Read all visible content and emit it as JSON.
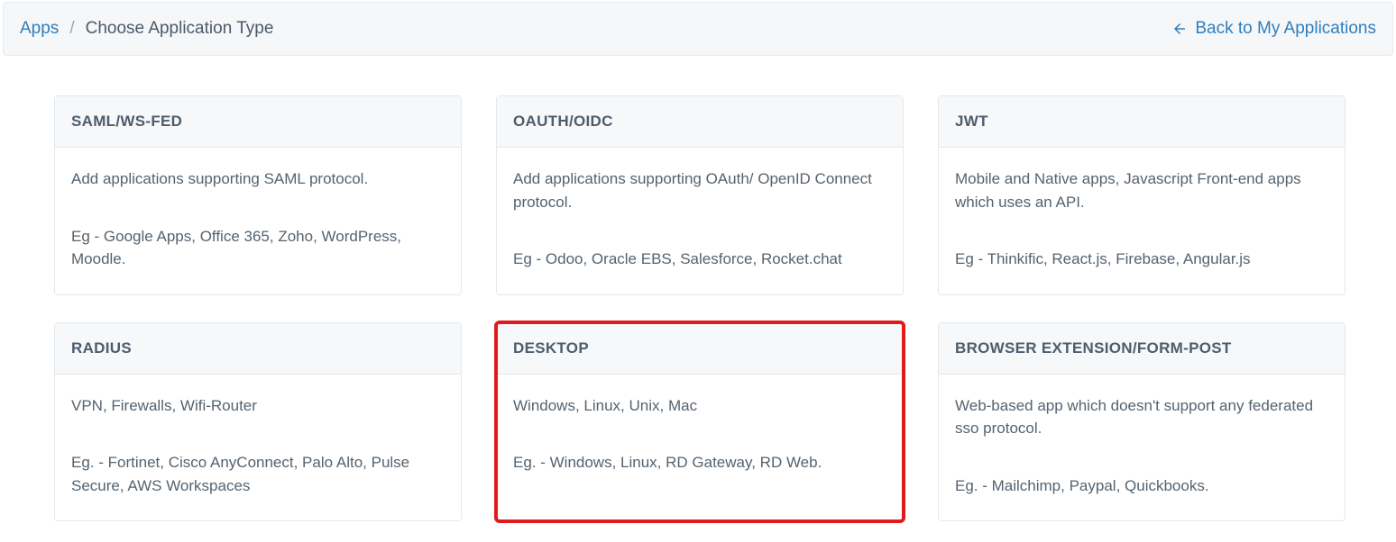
{
  "breadcrumb": {
    "root": "Apps",
    "current": "Choose Application Type"
  },
  "back_link": "Back to My Applications",
  "cards": [
    {
      "title": "SAML/WS-FED",
      "desc": "Add applications supporting SAML protocol.",
      "eg": "Eg - Google Apps, Office 365, Zoho, WordPress, Moodle.",
      "highlight": false
    },
    {
      "title": "OAUTH/OIDC",
      "desc": "Add applications supporting OAuth/ OpenID Connect protocol.",
      "eg": "Eg - Odoo, Oracle EBS, Salesforce, Rocket.chat",
      "highlight": false
    },
    {
      "title": "JWT",
      "desc": "Mobile and Native apps, Javascript Front-end apps which uses an API.",
      "eg": "Eg - Thinkific, React.js, Firebase, Angular.js",
      "highlight": false
    },
    {
      "title": "RADIUS",
      "desc": "VPN, Firewalls, Wifi-Router",
      "eg": "Eg. - Fortinet, Cisco AnyConnect, Palo Alto, Pulse Secure, AWS Workspaces",
      "highlight": false
    },
    {
      "title": "DESKTOP",
      "desc": "Windows, Linux, Unix, Mac",
      "eg": "Eg. - Windows, Linux, RD Gateway, RD Web.",
      "highlight": true
    },
    {
      "title": "BROWSER EXTENSION/FORM-POST",
      "desc": "Web-based app which doesn't support any federated sso protocol.",
      "eg": "Eg. - Mailchimp, Paypal, Quickbooks.",
      "highlight": false
    }
  ]
}
